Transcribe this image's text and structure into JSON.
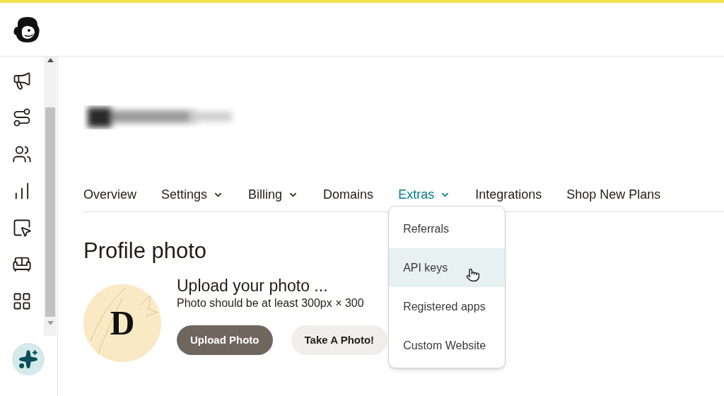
{
  "nav_tabs": [
    {
      "label": "Overview",
      "dropdown": false,
      "selected": false
    },
    {
      "label": "Settings",
      "dropdown": true,
      "selected": false
    },
    {
      "label": "Billing",
      "dropdown": true,
      "selected": false
    },
    {
      "label": "Domains",
      "dropdown": false,
      "selected": false
    },
    {
      "label": "Extras",
      "dropdown": true,
      "selected": true
    },
    {
      "label": "Integrations",
      "dropdown": false,
      "selected": false
    },
    {
      "label": "Shop New Plans",
      "dropdown": false,
      "selected": false
    }
  ],
  "extras_menu": {
    "items": [
      {
        "label": "Referrals",
        "hovered": false
      },
      {
        "label": "API keys",
        "hovered": true
      },
      {
        "label": "Registered apps",
        "hovered": false
      },
      {
        "label": "Custom Website",
        "hovered": false
      }
    ]
  },
  "profile_photo": {
    "heading": "Profile photo",
    "avatar_initial": "D",
    "title": "Upload your photo ...",
    "hint": "Photo should be at least 300px × 300",
    "buttons": [
      {
        "label": "Upload Photo",
        "kind": "primary"
      },
      {
        "label": "Take A Photo!",
        "kind": "secondary"
      }
    ]
  }
}
